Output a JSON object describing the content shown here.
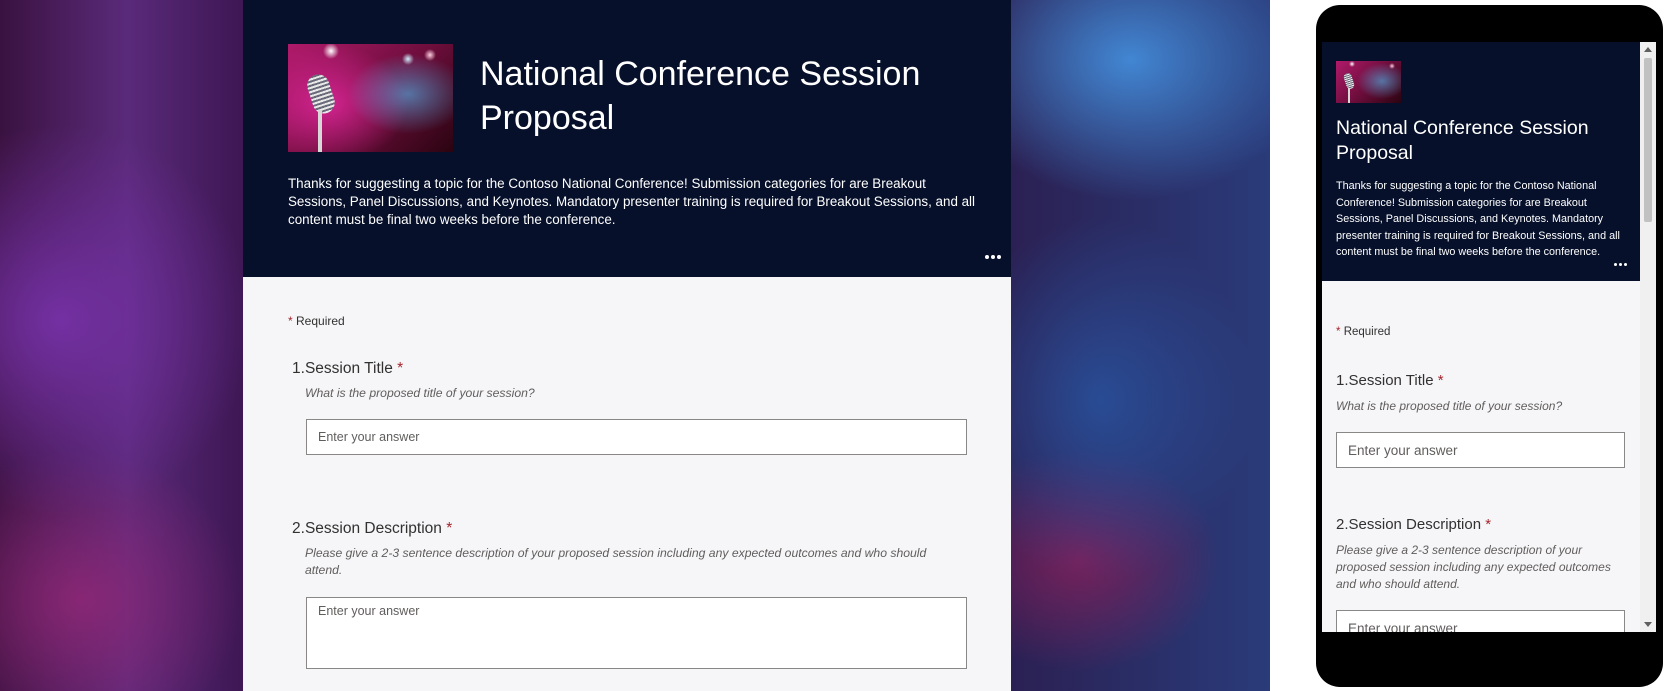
{
  "form": {
    "title": "National Conference Session Proposal",
    "description": "Thanks for suggesting a topic for the Contoso National Conference! Submission categories for are Breakout Sessions, Panel Discussions, and Keynotes. Mandatory presenter training is required for Breakout Sessions, and all content must be final two weeks before the conference.",
    "more_icon": "more-horizontal-icon",
    "required_star": "*",
    "required_label": "Required",
    "questions": [
      {
        "number": "1.",
        "title": "Session Title",
        "star": "*",
        "subtitle": "What is the proposed title of your session?",
        "placeholder": "Enter your answer"
      },
      {
        "number": "2.",
        "title": "Session Description",
        "star": "*",
        "subtitle": "Please give a 2-3 sentence description of your proposed session including any expected outcomes and who should attend.",
        "placeholder": "Enter your answer"
      }
    ]
  },
  "colors": {
    "header_bg": "#06102a",
    "required_star": "#a4262c",
    "body_bg": "#f6f5f8"
  }
}
